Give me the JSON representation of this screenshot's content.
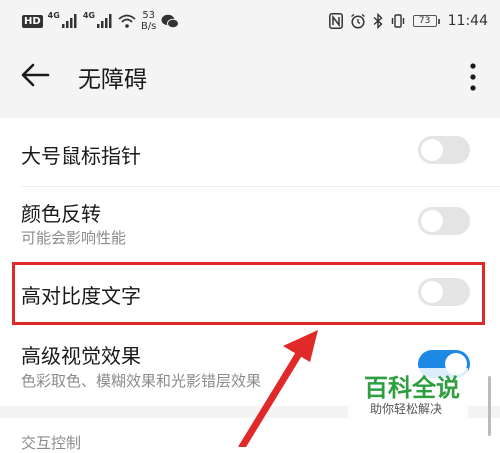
{
  "status_bar": {
    "hd_badge": "HD",
    "sim1_net": "4G",
    "sim2_net": "4G",
    "speed_value": "53",
    "speed_unit": "B/s",
    "battery": "73",
    "time": "11:44"
  },
  "header": {
    "title": "无障碍"
  },
  "settings": {
    "items": [
      {
        "title": "大号鼠标指针",
        "subtitle": "",
        "enabled": false
      },
      {
        "title": "颜色反转",
        "subtitle": "可能会影响性能",
        "enabled": false
      },
      {
        "title": "高对比度文字",
        "subtitle": "",
        "enabled": false
      },
      {
        "title": "高级视觉效果",
        "subtitle": "色彩取色、模糊效果和光影错层效果",
        "enabled": true
      }
    ],
    "next_section_label": "交互控制"
  },
  "watermark": {
    "title": "百科全说",
    "subtitle": "助你轻松解决"
  },
  "colors": {
    "accent": "#1e88e5",
    "highlight": "#e02a2a",
    "watermark": "#2e9e3f"
  }
}
